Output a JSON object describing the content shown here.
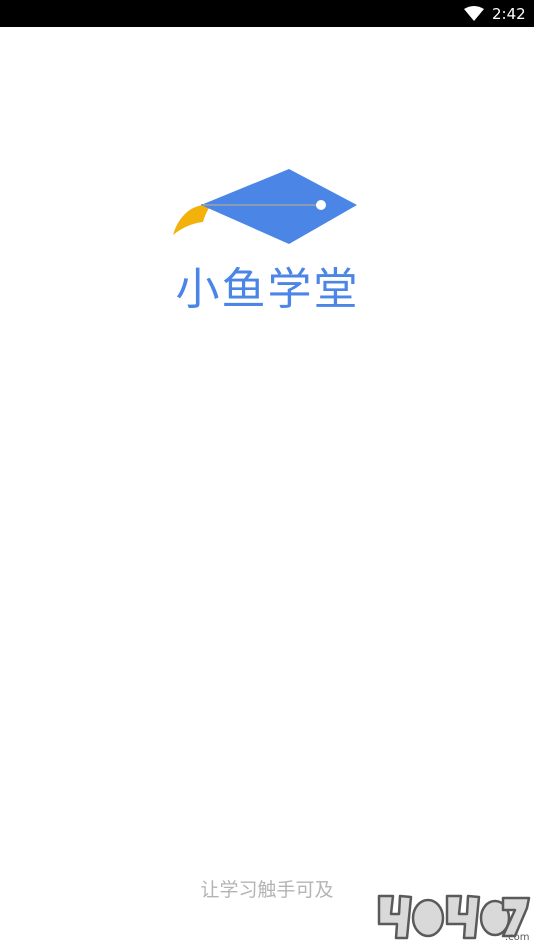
{
  "status_bar": {
    "time": "2:42",
    "wifi_icon": "wifi-icon",
    "background": "#000000"
  },
  "app": {
    "name": "小鱼学堂",
    "slogan": "让学习触手可及",
    "logo_icon": "graduation-cap-fish-icon",
    "brand_color": "#4b86e6",
    "accent_color": "#f2b10b"
  },
  "watermark": {
    "text": "4O4O7"
  }
}
